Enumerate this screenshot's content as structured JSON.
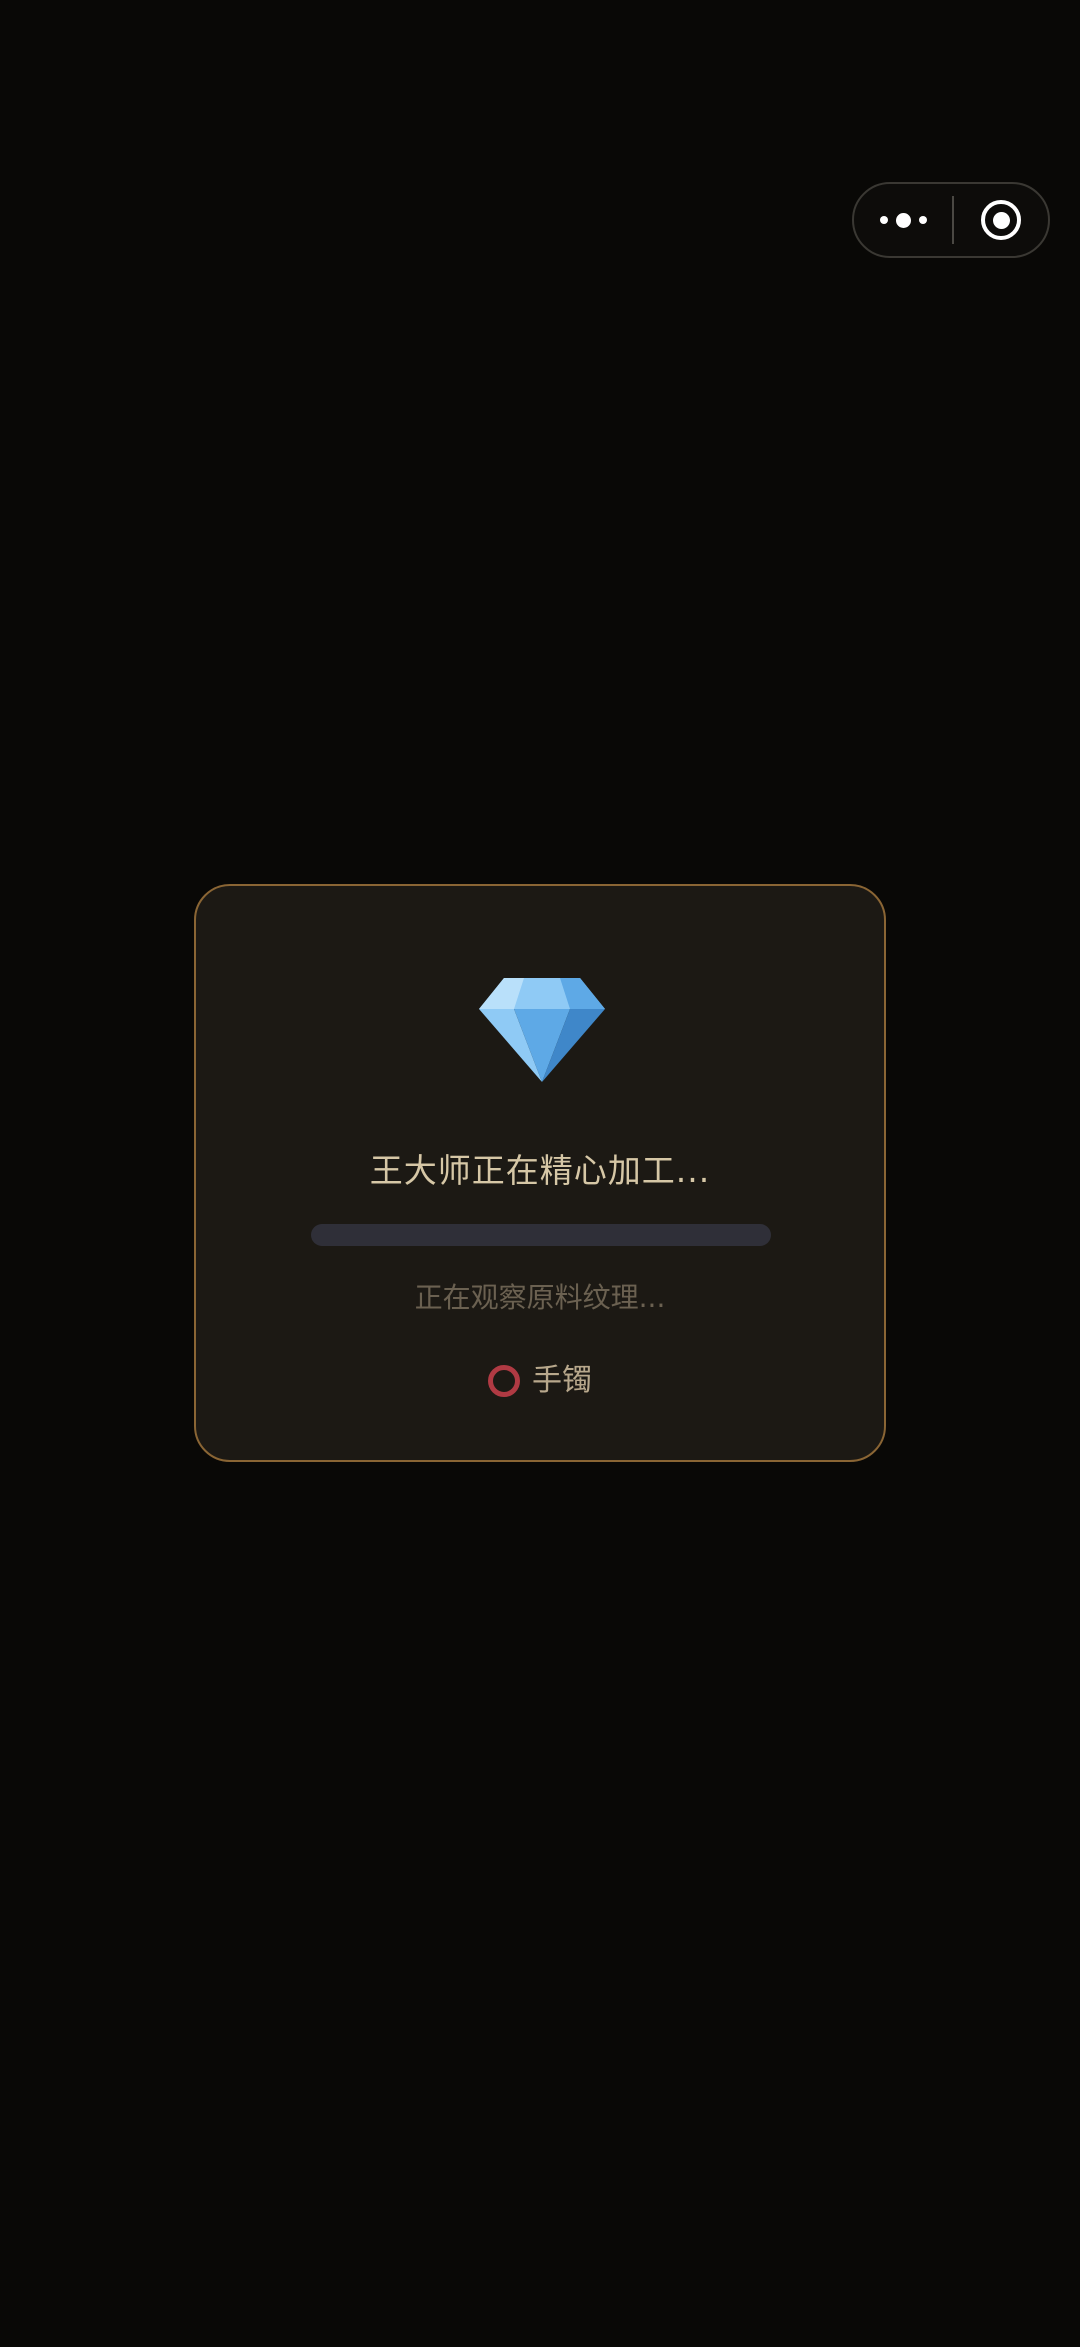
{
  "capsule": {
    "more_icon": "more-dots-icon",
    "close_icon": "close-target-icon"
  },
  "loading_card": {
    "icon": "diamond-icon",
    "title": "王大师正在精心加工...",
    "progress": 0,
    "status_text": "正在观察原料纹理...",
    "item": {
      "icon": "bracelet-ring-icon",
      "label": "手镯"
    }
  },
  "colors": {
    "background": "#090806",
    "card_background": "#1c1914",
    "card_border": "#8a6534",
    "title_text": "#d6c7a6",
    "status_text": "#6b6151",
    "progress_track": "#2f2f38",
    "item_ring": "#b03a43"
  }
}
